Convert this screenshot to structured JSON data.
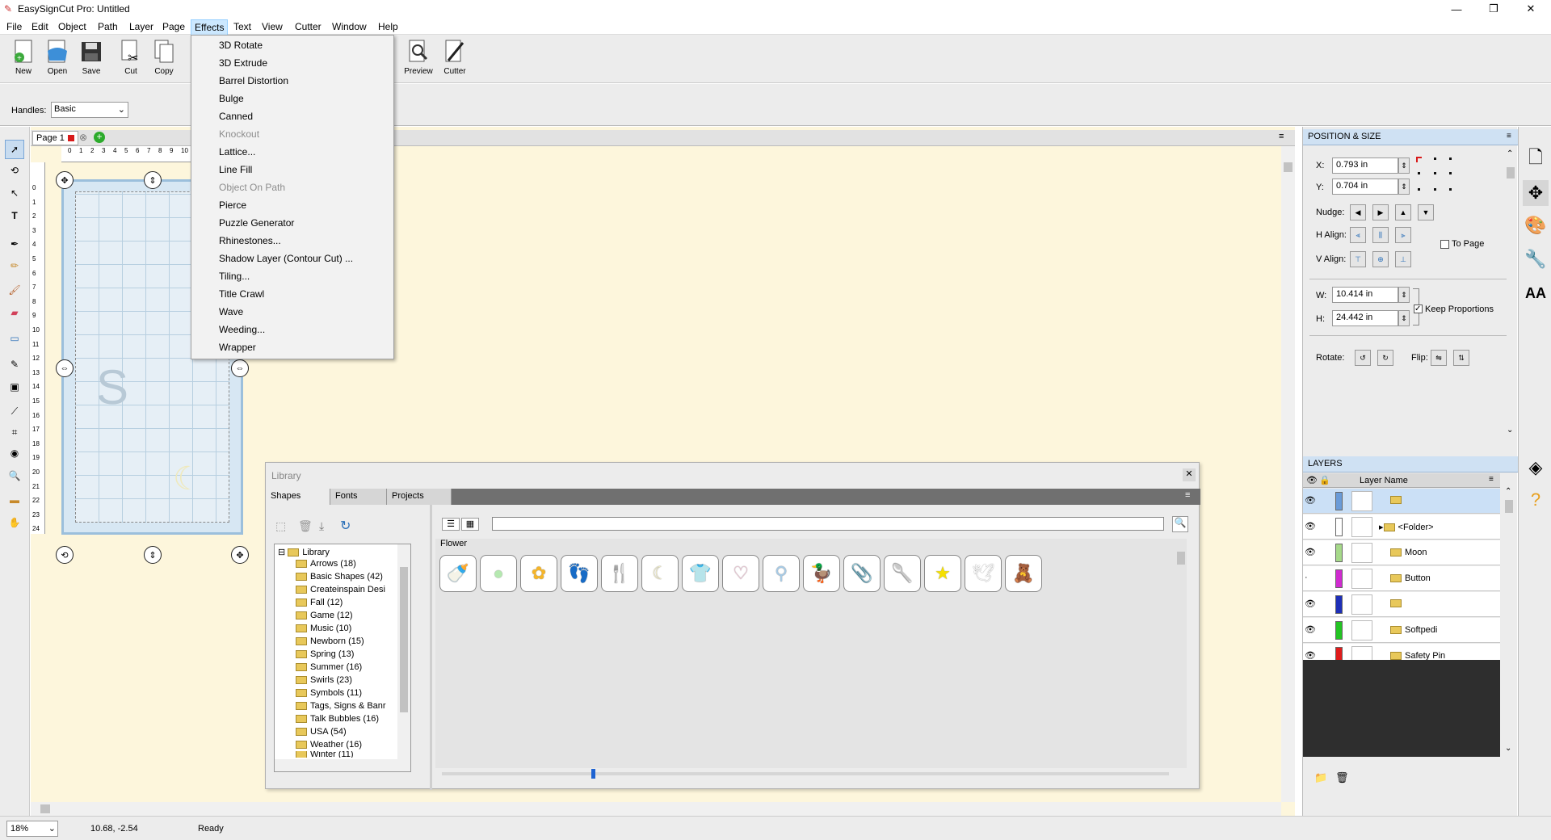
{
  "window": {
    "title": "EasySignCut Pro: Untitled",
    "controls": [
      "—",
      "❐",
      "✕"
    ]
  },
  "menubar": [
    "File",
    "Edit",
    "Object",
    "Path",
    "Layer",
    "Page",
    "Effects",
    "Text",
    "View",
    "Cutter",
    "Window",
    "Help"
  ],
  "toolbar": {
    "buttons": [
      {
        "label": "New",
        "icon": "new-doc-icon"
      },
      {
        "label": "Open",
        "icon": "open-icon"
      },
      {
        "label": "Save",
        "icon": "save-icon"
      },
      {
        "label": "Cut",
        "icon": "scissors-icon"
      },
      {
        "label": "Copy",
        "icon": "copy-icon"
      },
      {
        "label": "Preview",
        "icon": "preview-icon"
      },
      {
        "label": "Cutter",
        "icon": "cutter-icon"
      }
    ]
  },
  "options": {
    "handles_label": "Handles:",
    "handles_value": "Basic"
  },
  "page_tab": {
    "label": "Page 1"
  },
  "ruler": {
    "h": [
      "0",
      "1",
      "2",
      "3",
      "4",
      "5",
      "6",
      "7",
      "8",
      "9",
      "10"
    ],
    "v": [
      "0",
      "1",
      "2",
      "3",
      "4",
      "5",
      "6",
      "7",
      "8",
      "9",
      "10",
      "11",
      "12",
      "13",
      "14",
      "15",
      "16",
      "17",
      "18",
      "19",
      "20",
      "21",
      "22",
      "23",
      "24"
    ]
  },
  "effects_menu": [
    {
      "label": "3D Rotate",
      "enabled": true
    },
    {
      "label": "3D Extrude",
      "enabled": true
    },
    {
      "label": "Barrel Distortion",
      "enabled": true
    },
    {
      "label": "Bulge",
      "enabled": true
    },
    {
      "label": "Canned",
      "enabled": true
    },
    {
      "label": "Knockout",
      "enabled": false
    },
    {
      "label": "Lattice...",
      "enabled": true
    },
    {
      "label": "Line Fill",
      "enabled": true
    },
    {
      "label": "Object On Path",
      "enabled": false
    },
    {
      "label": "Pierce",
      "enabled": true
    },
    {
      "label": "Puzzle Generator",
      "enabled": true
    },
    {
      "label": "Rhinestones...",
      "enabled": true
    },
    {
      "label": "Shadow Layer (Contour Cut) ...",
      "enabled": true
    },
    {
      "label": "Tiling...",
      "enabled": true
    },
    {
      "label": "Title Crawl",
      "enabled": true
    },
    {
      "label": "Wave",
      "enabled": true
    },
    {
      "label": "Weeding...",
      "enabled": true
    },
    {
      "label": "Wrapper",
      "enabled": true
    }
  ],
  "library": {
    "title": "Library",
    "tabs": [
      "Shapes",
      "Fonts",
      "Projects"
    ],
    "tree_root": "Library",
    "tree_items": [
      "Arrows (18)",
      "Basic Shapes (42)",
      "Createinspain Desi",
      "Fall (12)",
      "Game (12)",
      "Music (10)",
      "Newborn (15)",
      "Spring (13)",
      "Summer (16)",
      "Swirls (23)",
      "Symbols (11)",
      "Tags, Signs & Banr",
      "Talk Bubbles (16)",
      "USA (54)",
      "Weather (16)",
      "Winter (11)"
    ],
    "search_value": "",
    "selected_label": "Flower",
    "shapes": [
      {
        "name": "bottle-shape",
        "glyph": "🍼",
        "color": "#ffffff"
      },
      {
        "name": "button-shape",
        "glyph": "●",
        "color": "#b5e8b0"
      },
      {
        "name": "flower-shape",
        "glyph": "✿",
        "color": "#f5b52a"
      },
      {
        "name": "footprints-shape",
        "glyph": "👣",
        "color": "#ffffff"
      },
      {
        "name": "fork-shape",
        "glyph": "🍴",
        "color": "#ffffff"
      },
      {
        "name": "moon-shape",
        "glyph": "☾",
        "color": "#f5f0c8"
      },
      {
        "name": "onesie-shape",
        "glyph": "👕",
        "color": "#ffffff"
      },
      {
        "name": "pacifier-shape",
        "glyph": "♡",
        "color": "#f7c2d6"
      },
      {
        "name": "rattle-shape",
        "glyph": "⚲",
        "color": "#a7cbe6"
      },
      {
        "name": "duck-shape",
        "glyph": "🦆",
        "color": "#f5e000"
      },
      {
        "name": "safety-pin-shape",
        "glyph": "📎",
        "color": "#ffffff"
      },
      {
        "name": "spoon-shape",
        "glyph": "🥄",
        "color": "#ffffff"
      },
      {
        "name": "star-shape",
        "glyph": "★",
        "color": "#f5e000"
      },
      {
        "name": "stork-shape",
        "glyph": "🕊",
        "color": "#ffffff"
      },
      {
        "name": "teddy-bear-shape",
        "glyph": "🧸",
        "color": "#a4592c"
      }
    ]
  },
  "position_size": {
    "header": "POSITION & SIZE",
    "x_label": "X:",
    "x_value": "0.793 in",
    "y_label": "Y:",
    "y_value": "0.704 in",
    "nudge_label": "Nudge:",
    "halign_label": "H Align:",
    "valign_label": "V Align:",
    "to_page_label": "To Page",
    "w_label": "W:",
    "w_value": "10.414 in",
    "h_label": "H:",
    "h_value": "24.442 in",
    "keep_label": "Keep Proportions",
    "rotate_label": "Rotate:",
    "flip_label": "Flip:"
  },
  "layers": {
    "header": "LAYERS",
    "col_header": "Layer Name",
    "rows": [
      {
        "name": "",
        "color": "#6a9bd8",
        "visible": true,
        "selected": true,
        "folder": false
      },
      {
        "name": "<Folder>",
        "color": "#ffffff",
        "visible": true,
        "selected": false,
        "folder": true
      },
      {
        "name": "Moon",
        "color": "#a6d98a",
        "visible": true,
        "selected": false,
        "folder": false
      },
      {
        "name": "Button",
        "color": "#d02bd0",
        "visible": false,
        "selected": false,
        "folder": false
      },
      {
        "name": "",
        "color": "#1e2fb8",
        "visible": true,
        "selected": false,
        "folder": false
      },
      {
        "name": "Softpedi",
        "color": "#23c423",
        "visible": true,
        "selected": false,
        "folder": false
      },
      {
        "name": "Safety Pin",
        "color": "#e01b1b",
        "visible": true,
        "selected": false,
        "folder": false
      }
    ]
  },
  "status": {
    "zoom": "18%",
    "coords": "10.68, -2.54",
    "state": "Ready"
  }
}
